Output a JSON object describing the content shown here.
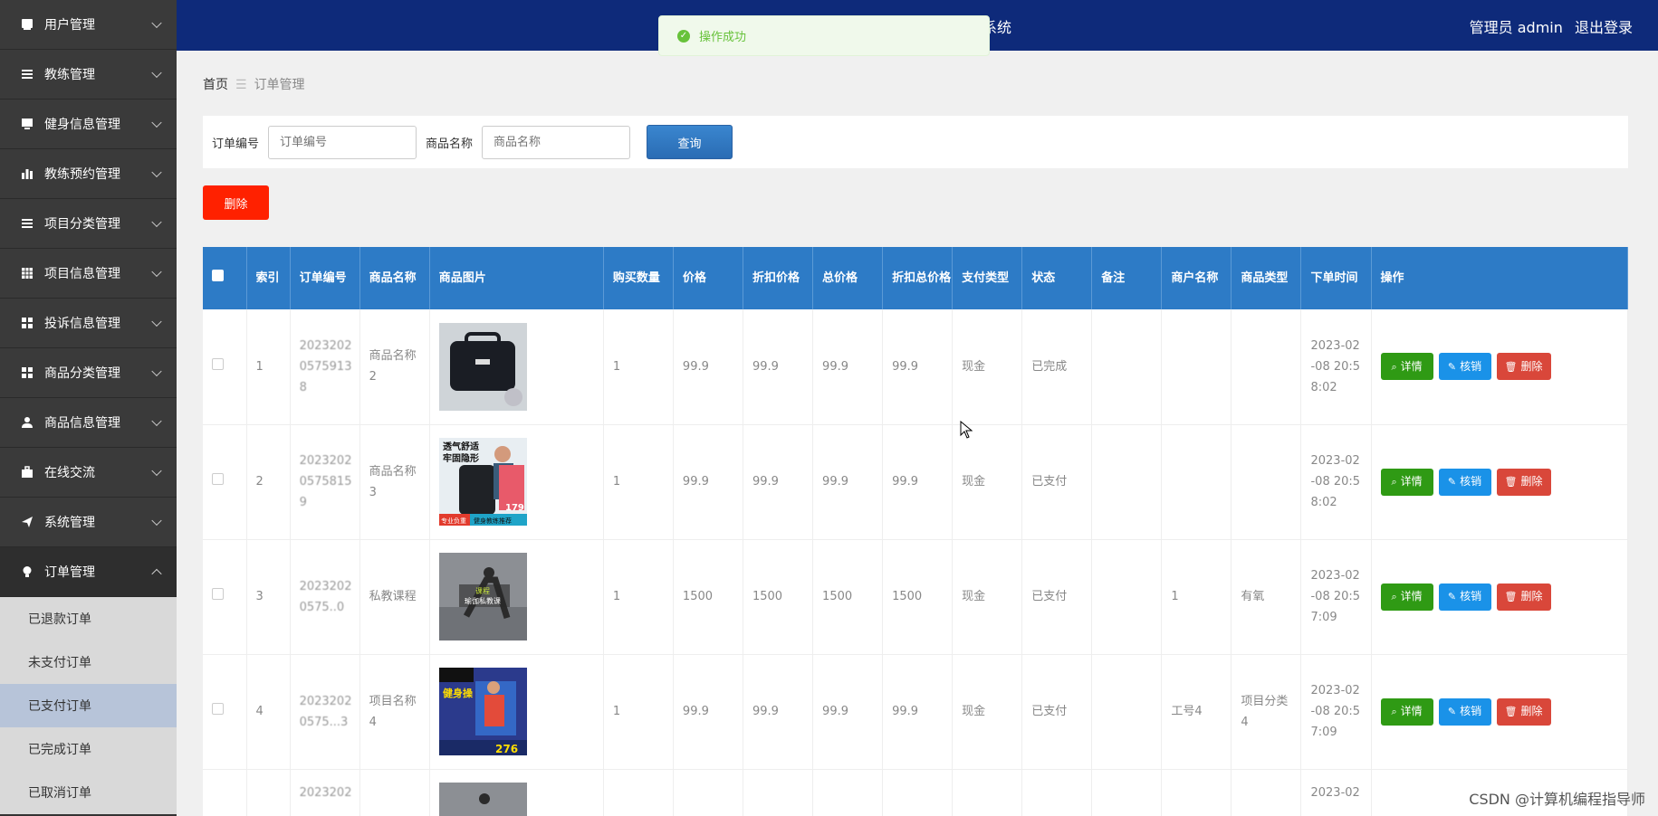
{
  "sidebar": {
    "items": [
      {
        "label": "用户管理",
        "icon": "user-card-icon"
      },
      {
        "label": "教练管理",
        "icon": "list-icon"
      },
      {
        "label": "健身信息管理",
        "icon": "monitor-icon"
      },
      {
        "label": "教练预约管理",
        "icon": "chart-icon"
      },
      {
        "label": "项目分类管理",
        "icon": "list-icon"
      },
      {
        "label": "项目信息管理",
        "icon": "table-icon"
      },
      {
        "label": "投诉信息管理",
        "icon": "grid-icon"
      },
      {
        "label": "商品分类管理",
        "icon": "grid-icon"
      },
      {
        "label": "商品信息管理",
        "icon": "person-icon"
      },
      {
        "label": "在线交流",
        "icon": "briefcase-icon"
      },
      {
        "label": "系统管理",
        "icon": "send-icon"
      },
      {
        "label": "订单管理",
        "icon": "lightbulb-icon"
      }
    ],
    "sub_items": [
      "已退款订单",
      "未支付订单",
      "已支付订单",
      "已完成订单",
      "已取消订单"
    ]
  },
  "header": {
    "title_fragment": "系统",
    "user_label": "管理员 admin",
    "logout": "退出登录"
  },
  "toast": {
    "message": "操作成功"
  },
  "breadcrumb": {
    "home": "首页",
    "separator": "☰",
    "current": "订单管理"
  },
  "search": {
    "order_no_label": "订单编号",
    "order_no_placeholder": "订单编号",
    "product_name_label": "商品名称",
    "product_name_placeholder": "商品名称",
    "query_button": "查询"
  },
  "delete_button": "删除",
  "table": {
    "headers": [
      "索引",
      "订单编号",
      "商品名称",
      "商品图片",
      "购买数量",
      "价格",
      "折扣价格",
      "总价格",
      "折扣总价格",
      "支付类型",
      "状态",
      "备注",
      "商户名称",
      "商品类型",
      "下单时间",
      "操作"
    ],
    "actions": {
      "detail": "详情",
      "verify": "核销",
      "delete": "删除"
    },
    "rows": [
      {
        "index": "1",
        "order_no": "2023202\n0575913\n8",
        "product": "商品名称\n2",
        "image": "bag",
        "qty": "1",
        "price": "99.9",
        "discount": "99.9",
        "total": "99.9",
        "discount_total": "99.9",
        "pay": "现金",
        "status": "已完成",
        "remark": "",
        "merchant": "",
        "type": "",
        "time": "2023-02\n-08 20:5\n8:02"
      },
      {
        "index": "2",
        "order_no": "2023202\n0575815\n9",
        "product": "商品名称\n3",
        "image": "vest",
        "qty": "1",
        "price": "99.9",
        "discount": "99.9",
        "total": "99.9",
        "discount_total": "99.9",
        "pay": "现金",
        "status": "已支付",
        "remark": "",
        "merchant": "",
        "type": "",
        "time": "2023-02\n-08 20:5\n8:02"
      },
      {
        "index": "3",
        "order_no": "2023202\n0575..0",
        "product": "私教课程",
        "image": "yoga",
        "qty": "1",
        "price": "1500",
        "discount": "1500",
        "total": "1500",
        "discount_total": "1500",
        "pay": "现金",
        "status": "已支付",
        "remark": "",
        "merchant": "1",
        "type": "有氧",
        "time": "2023-02\n-08 20:5\n7:09"
      },
      {
        "index": "4",
        "order_no": "2023202\n0575...3",
        "product": "项目名称\n4",
        "image": "gym",
        "qty": "1",
        "price": "99.9",
        "discount": "99.9",
        "total": "99.9",
        "discount_total": "99.9",
        "pay": "现金",
        "status": "已支付",
        "remark": "",
        "merchant": "工号4",
        "type": "项目分类\n4",
        "time": "2023-02\n-08 20:5\n7:09"
      },
      {
        "index": "",
        "order_no": "2023202",
        "product": "",
        "image": "partial",
        "qty": "",
        "price": "",
        "discount": "",
        "total": "",
        "discount_total": "",
        "pay": "",
        "status": "",
        "remark": "",
        "merchant": "",
        "type": "",
        "time": "2023-02"
      }
    ]
  },
  "image_text": {
    "vest_line1": "透气舒适",
    "vest_line2": "牢固隐形",
    "vest_price": "179",
    "vest_tag1": "专业负重",
    "vest_tag2": "健身教练推荐",
    "yoga_line1": "课程",
    "yoga_line2": "瑜伽私教课",
    "gym_line1": "健身操",
    "gym_price": "276"
  },
  "watermark": "CSDN @计算机编程指导师",
  "colors": {
    "header": "#0e2a7a",
    "table_header": "#2d7bc6",
    "sidebar": "#333333",
    "delete": "#ff2100",
    "success": "#67c23a"
  }
}
